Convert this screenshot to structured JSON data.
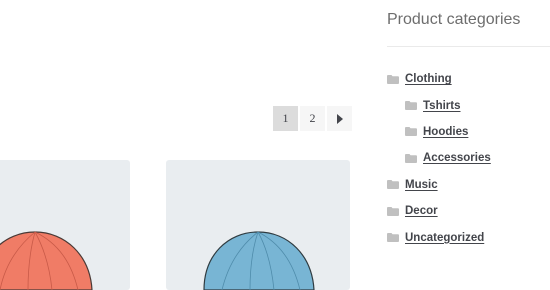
{
  "pagination": {
    "pages": [
      "1",
      "2"
    ],
    "current": "1",
    "next_icon": "caret-right-icon"
  },
  "products": [
    {
      "image_icon": "beanie-hat-icon",
      "hat_color": "#f07c66",
      "card_bg": "#e9edf0"
    },
    {
      "image_icon": "beanie-hat-icon",
      "hat_color": "#78b5d4",
      "card_bg": "#e9edf0"
    }
  ],
  "sidebar": {
    "title": "Product categories",
    "folder_icon": "folder-icon",
    "folder_color": "#c0c0c0",
    "categories": [
      {
        "label": "Clothing",
        "level": 0
      },
      {
        "label": "Tshirts",
        "level": 1
      },
      {
        "label": "Hoodies",
        "level": 1
      },
      {
        "label": "Accessories",
        "level": 1
      },
      {
        "label": "Music",
        "level": 0
      },
      {
        "label": "Decor",
        "level": 0
      },
      {
        "label": "Uncategorized",
        "level": 0
      }
    ]
  }
}
